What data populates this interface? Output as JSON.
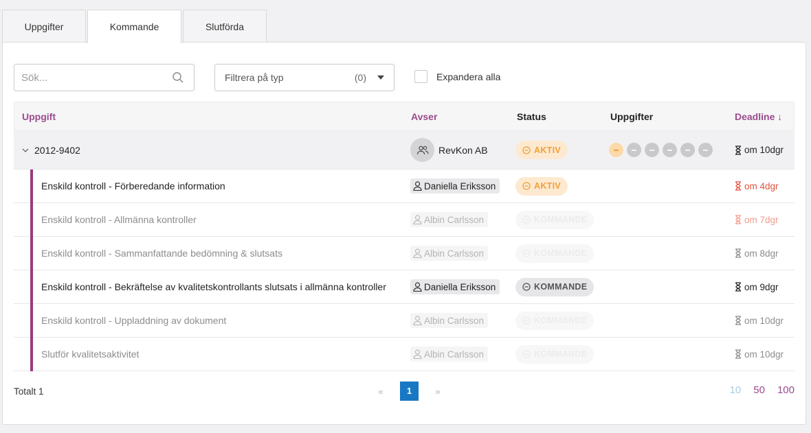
{
  "tabs": [
    {
      "label": "Uppgifter"
    },
    {
      "label": "Kommande"
    },
    {
      "label": "Slutförda"
    }
  ],
  "toolbar": {
    "search_placeholder": "Sök...",
    "filter_label": "Filtrera på typ",
    "filter_count": "(0)",
    "expand_label": "Expandera alla",
    "expand_checked": false
  },
  "table": {
    "headers": {
      "task": "Uppgift",
      "regarding": "Avser",
      "status": "Status",
      "tasks": "Uppgifter",
      "deadline": "Deadline ↓"
    },
    "group": {
      "id": "2012-9402",
      "client": "RevKon AB",
      "status": "AKTIV",
      "deadline": "om 10dgr",
      "progress_steps": 6,
      "progress_active_index": 0
    },
    "rows": [
      {
        "task": "Enskild kontroll - Förberedande information",
        "person": "Daniella Eriksson",
        "status": "AKTIV",
        "deadline": "om 4dgr"
      },
      {
        "task": "Enskild kontroll - Allmänna kontroller",
        "person": "Albin Carlsson",
        "status": "KOMMANDE",
        "deadline": "om 7dgr"
      },
      {
        "task": "Enskild kontroll - Sammanfattande bedömning & slutsats",
        "person": "Albin Carlsson",
        "status": "KOMMANDE",
        "deadline": "om 8dgr"
      },
      {
        "task": "Enskild kontroll - Bekräftelse av kvalitetskontrollants slutsats i allmänna kontroller",
        "person": "Daniella Eriksson",
        "status": "KOMMANDE",
        "deadline": "om 9dgr"
      },
      {
        "task": "Enskild kontroll - Uppladdning av dokument",
        "person": "Albin Carlsson",
        "status": "KOMMANDE",
        "deadline": "om 10dgr"
      },
      {
        "task": "Slutför kvalitetsaktivitet",
        "person": "Albin Carlsson",
        "status": "KOMMANDE",
        "deadline": "om 10dgr"
      }
    ]
  },
  "footer": {
    "total": "Totalt 1",
    "prev": "«",
    "page": "1",
    "next": "»",
    "page_sizes": [
      "10",
      "50",
      "100"
    ]
  },
  "colors": {
    "accent_purple": "#9b4a8c",
    "active_orange": "#f0a03a",
    "overdue_red": "#e0533f",
    "pager_blue": "#1878c3"
  }
}
